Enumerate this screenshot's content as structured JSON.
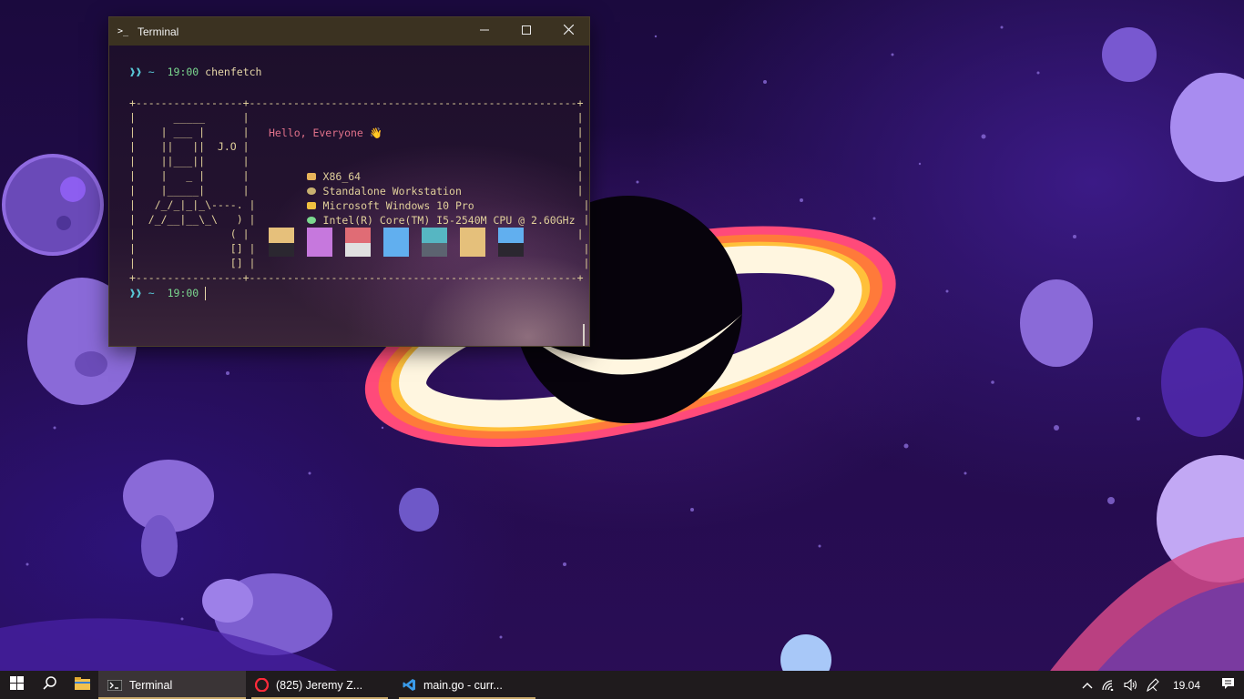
{
  "window": {
    "title": "Terminal",
    "title_icon": ">_",
    "controls": {
      "minimize": "—",
      "maximize": "☐",
      "close": "✕"
    }
  },
  "terminal": {
    "prompt_symbol": "❱❱",
    "prompt_tilde": "~",
    "prompt_time": "19:00",
    "command": "chenfetch",
    "second_prompt_time": "19:00",
    "ascii_art": "+-----------------+----------------------------------------------------+\n|      _____      |                                                    |\n|    | ___ |      |                                                    |\n|    ||   ||  J.O |                                                    |\n|    ||___||      |                                                    |\n|    |   _ |      |                                                    |\n|    |_____|      |                                                    |\n|   /_/_|_|_\\----. |                                                    |\n|  /_/__|__\\_\\   ) |                                                    |\n|               ( |                                                    |\n|               [] |                                                    |\n|               [] |                                                    |\n+-----------------+----------------------------------------------------+",
    "greeting": "Hello, Everyone 👋",
    "info": [
      {
        "icon": "cpu-arch-icon",
        "color": "#e8b45a",
        "text": "X86_64"
      },
      {
        "icon": "workstation-icon",
        "color": "#c8b070",
        "text": "Standalone Workstation"
      },
      {
        "icon": "os-icon",
        "color": "#f0c040",
        "text": "Microsoft Windows 10 Pro"
      },
      {
        "icon": "cpu-icon",
        "color": "#7bd88f",
        "text": "Intel(R) Core(TM) I5-2540M CPU @ 2.60GHz"
      }
    ],
    "swatches": [
      {
        "top": "#e6c07b",
        "bottom": "#2b2730"
      },
      {
        "top": "#c678dd",
        "bottom": "#c678dd"
      },
      {
        "top": "#e06c75",
        "bottom": "#e0e0e0"
      },
      {
        "top": "#61afef",
        "bottom": "#61afef"
      },
      {
        "top": "#56b6c2",
        "bottom": "#5c6370"
      },
      {
        "top": "#e5c07b",
        "bottom": "#e5c07b"
      },
      {
        "top": "#61afef",
        "bottom": "#2b2730"
      }
    ]
  },
  "taskbar": {
    "tasks": [
      {
        "label": "Terminal",
        "icon": "terminal-icon",
        "active": true
      },
      {
        "label": "(825) Jeremy Z...",
        "icon": "opera-icon",
        "active": false
      },
      {
        "label": "main.go - curr...",
        "icon": "vscode-icon",
        "active": false
      }
    ],
    "clock": "19.04",
    "tray_icons": [
      "chevron-up-icon",
      "wifi-icon",
      "volume-icon",
      "pen-icon"
    ]
  }
}
